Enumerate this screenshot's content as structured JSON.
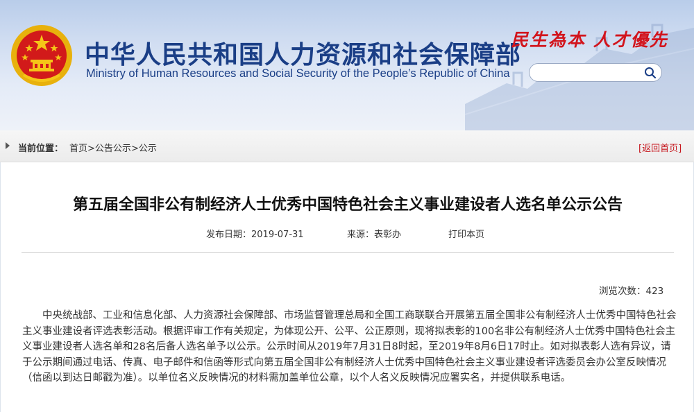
{
  "header": {
    "title_cn": "中华人民共和国人力资源和社会保障部",
    "title_en": "Ministry of Human Resources and Social Security of the People’s Republic of China",
    "slogan": "民生為本 人才優先",
    "search": {
      "placeholder": "",
      "value": ""
    }
  },
  "breadcrumb": {
    "label": "当前位置：",
    "items": [
      "首页",
      "公告公示",
      "公示"
    ],
    "separator": ">",
    "back_home": "[返回首页]"
  },
  "article": {
    "title": "第五届全国非公有制经济人士优秀中国特色社会主义事业建设者人选名单公示公告",
    "date": "发布日期：2019-07-31",
    "source": "来源：表彰办",
    "print": "打印本页",
    "views": "浏览次数：423",
    "paragraph": "中央统战部、工业和信息化部、人力资源社会保障部、市场监督管理总局和全国工商联联合开展第五届全国非公有制经济人士优秀中国特色社会主义事业建设者评选表彰活动。根据评审工作有关规定，为体现公开、公平、公正原则，现将拟表彰的100名非公有制经济人士优秀中国特色社会主义事业建设者人选名单和28名后备人选名单予以公示。公示时间从2019年7月31日8时起，至2019年8月6日17时止。如对拟表彰人选有异议，请于公示期间通过电话、传真、电子邮件和信函等形式向第五届全国非公有制经济人士优秀中国特色社会主义事业建设者评选委员会办公室反映情况（信函以到达日邮戳为准）。以单位名义反映情况的材料需加盖单位公章，以个人名义反映情况应署实名，并提供联系电话。"
  },
  "colors": {
    "brand_blue": "#1a3e86",
    "slogan_red": "#d2141c",
    "link_red": "#c6161d"
  },
  "icons": [
    "national-emblem-icon",
    "search-icon",
    "breadcrumb-arrow-icon"
  ]
}
